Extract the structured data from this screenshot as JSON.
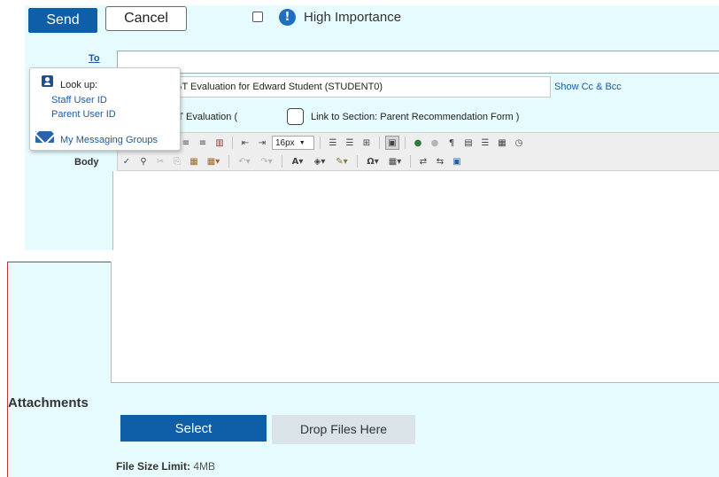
{
  "toolbar": {
    "send_label": "Send",
    "cancel_label": "Cancel",
    "high_importance_label": "High Importance",
    "high_importance_icon": "!"
  },
  "fields": {
    "to_label": "To",
    "to_value": "",
    "subject_value": "Request for GT Evaluation for Edward Student (STUDENT0)",
    "show_cc_bcc": "Show Cc & Bcc",
    "form_text": "Request for GT Evaluation (",
    "link_section_label": "Link to Section: Parent Recommendation Form )",
    "body_label": "Body"
  },
  "lookup_popup": {
    "title": "Look up:",
    "links": [
      "Staff User ID",
      "Parent User ID"
    ],
    "messaging_groups": "My Messaging Groups"
  },
  "editor": {
    "font_size": "16px",
    "row1_icons": [
      "abc",
      "≡",
      "≡",
      "≡",
      "≡",
      "▥",
      "⇤",
      "⇥",
      "font-size",
      "⋮≡",
      "•≡",
      "⊞",
      "▣",
      "●",
      "●",
      "¶",
      "▤",
      "☰",
      "▦",
      "◷"
    ],
    "row2_icons": [
      "✓",
      "⚲",
      "✂",
      "⎘",
      "▦",
      "▦▾",
      "↶",
      "↷",
      "A▾",
      "◈▾",
      "✎▾",
      "Ω▾",
      "▦▾",
      "⇄",
      "⇆",
      "▣"
    ]
  },
  "attachments": {
    "heading": "Attachments",
    "select_label": "Select",
    "drop_label": "Drop Files Here",
    "limit_label": "File Size Limit:",
    "limit_value": "4MB"
  }
}
